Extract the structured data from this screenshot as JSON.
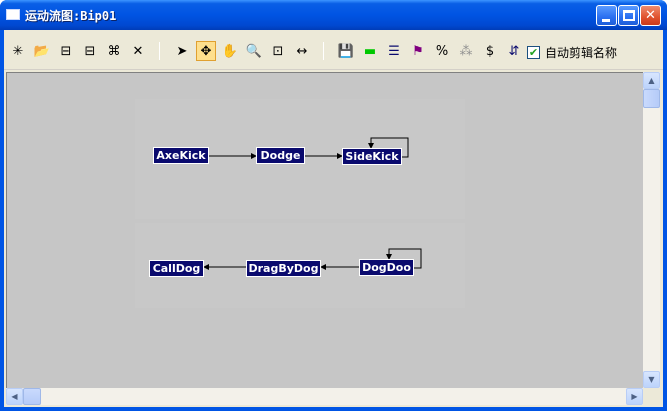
{
  "window": {
    "title": "运动流图:Bip01",
    "title_color": "#0054e3"
  },
  "toolbar": {
    "buttons": [
      {
        "name": "new-motion-flow-icon",
        "glyph": "✳"
      },
      {
        "name": "open-file-icon",
        "glyph": "📂"
      },
      {
        "name": "insert-node-icon",
        "glyph": "⊟"
      },
      {
        "name": "add-transition-icon",
        "glyph": "⊟"
      },
      {
        "name": "connect-nodes-icon",
        "glyph": "⌘"
      },
      {
        "name": "delete-icon",
        "glyph": "✕"
      },
      {
        "name": "select-arrow-icon",
        "glyph": "➤"
      },
      {
        "name": "move-icon",
        "glyph": "✥"
      },
      {
        "name": "pan-hand-icon",
        "glyph": "✋"
      },
      {
        "name": "zoom-icon",
        "glyph": "🔍"
      },
      {
        "name": "zoom-region-icon",
        "glyph": "⊡"
      },
      {
        "name": "fit-width-icon",
        "glyph": "↔"
      },
      {
        "name": "save-file-icon",
        "glyph": "💾"
      },
      {
        "name": "green-marker-icon",
        "glyph": "▬"
      },
      {
        "name": "script-properties-icon",
        "glyph": "☰"
      },
      {
        "name": "select-random-icon",
        "glyph": "⚑"
      },
      {
        "name": "percent-icon",
        "glyph": "%"
      },
      {
        "name": "random-links-icon",
        "glyph": "⁂"
      },
      {
        "name": "dollar-icon",
        "glyph": "$"
      },
      {
        "name": "optimize-icon",
        "glyph": "⇵"
      }
    ],
    "checkbox_checked": "✔",
    "checkbox_label": "自动剪辑名称"
  },
  "flow": {
    "nodes": [
      {
        "id": "axekick",
        "label": "AxeKick"
      },
      {
        "id": "dodge",
        "label": "Dodge"
      },
      {
        "id": "sidekick",
        "label": "SideKick"
      },
      {
        "id": "calldog",
        "label": "CallDog"
      },
      {
        "id": "dragbydog",
        "label": "DragByDog"
      },
      {
        "id": "dogdoo",
        "label": "DogDoo"
      }
    ],
    "transitions": [
      {
        "from": "AxeKick",
        "to": "Dodge"
      },
      {
        "from": "Dodge",
        "to": "SideKick"
      },
      {
        "from": "SideKick",
        "to": "SideKick"
      },
      {
        "from": "DogDoo",
        "to": "DragByDog"
      },
      {
        "from": "DragByDog",
        "to": "CallDog"
      },
      {
        "from": "DogDoo",
        "to": "DogDoo"
      }
    ],
    "node_color": "#0a0a6e",
    "canvas_color": "#c6c6c6"
  },
  "scrollbars": {
    "up": "▲",
    "down": "▼",
    "left": "◀",
    "right": "▶"
  }
}
